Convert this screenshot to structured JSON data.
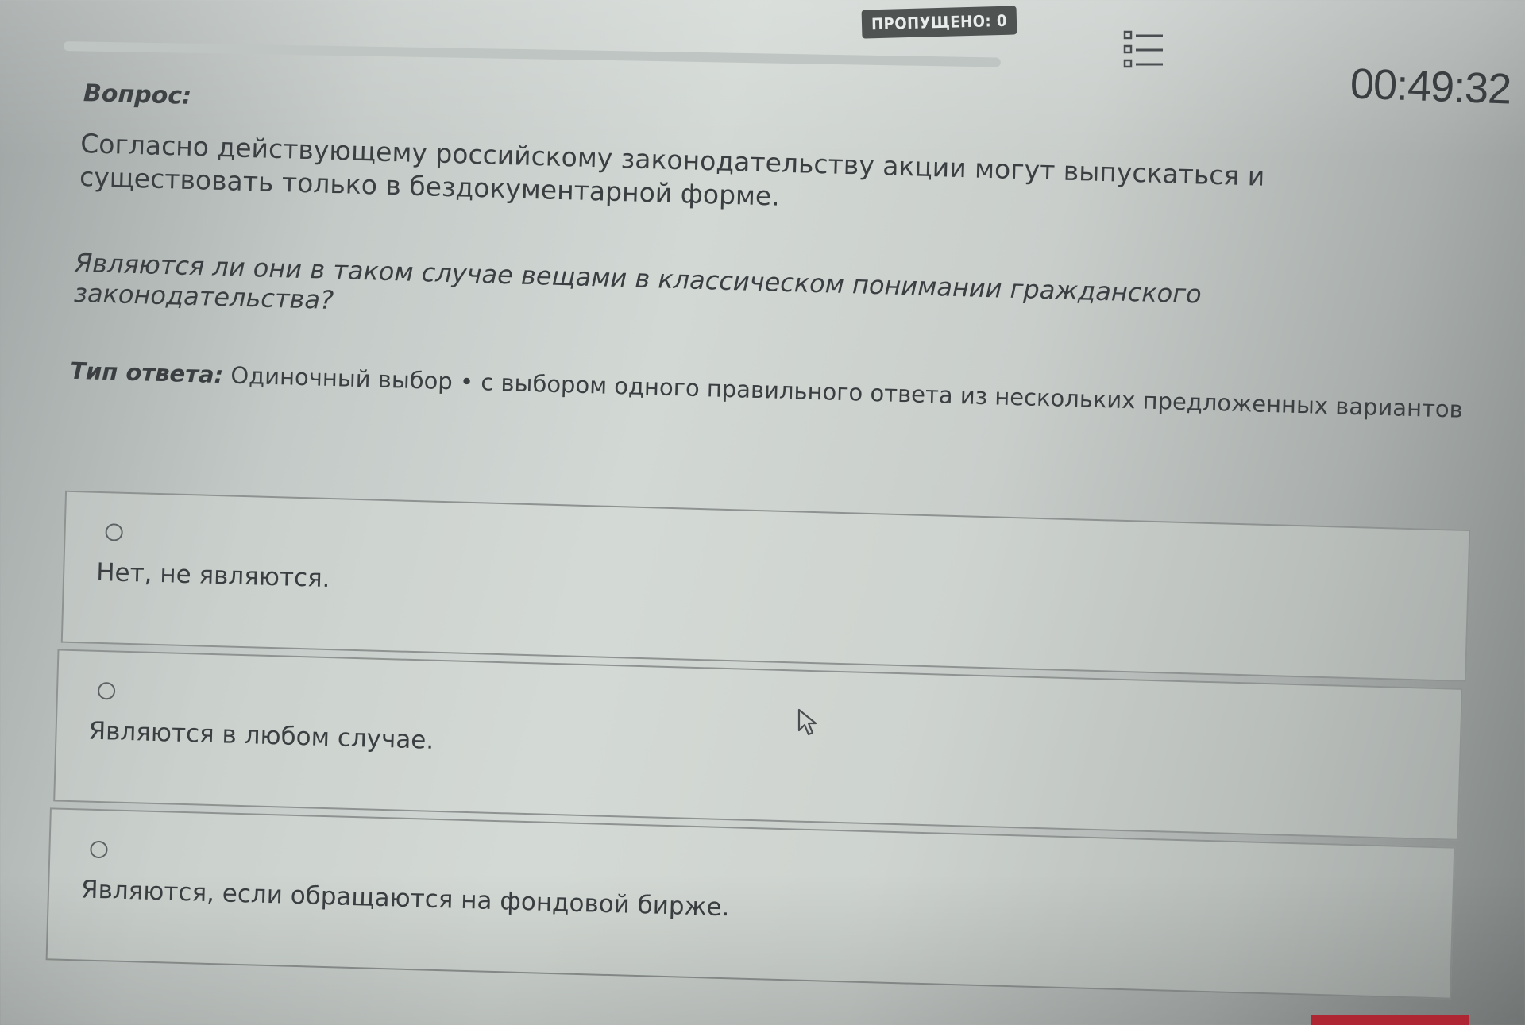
{
  "header": {
    "skipped_label": "ПРОПУЩЕНО: 0",
    "timer": "00:49:32",
    "list_icon": "question-list-icon"
  },
  "question": {
    "label": "Вопрос:",
    "text": "Согласно действующему российскому законодательству акции могут выпускаться и существовать только в бездокументарной форме.",
    "subquestion": "Являются ли они в таком случае вещами в классическом понимании гражданского законодательства?"
  },
  "answer_type": {
    "label": "Тип ответа:",
    "value": "Одиночный выбор • с выбором одного правильного ответа из нескольких предложенных вариантов"
  },
  "options": [
    {
      "label": "Нет, не являются.",
      "selected": false
    },
    {
      "label": "Являются в любом случае.",
      "selected": false
    },
    {
      "label": "Являются, если обращаются на фондовой бирже.",
      "selected": false
    }
  ],
  "colors": {
    "accent_button": "#c62b3a",
    "badge": "#4f5453"
  }
}
